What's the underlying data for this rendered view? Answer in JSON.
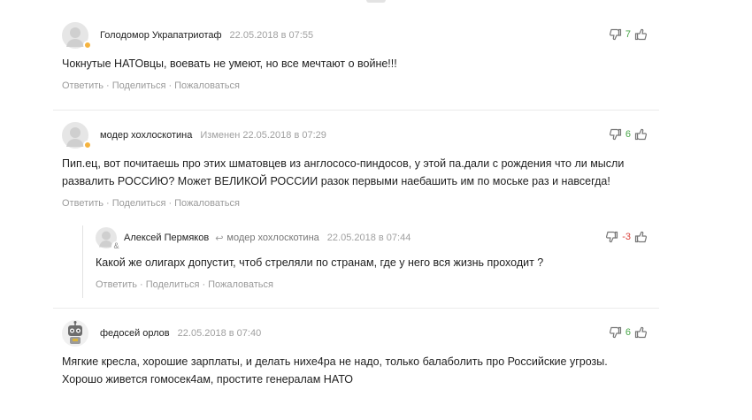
{
  "actions": {
    "reply": "Ответить",
    "share": "Поделиться",
    "report": "Пожаловаться",
    "separator": "·"
  },
  "reply_arrow": "↩",
  "comments": [
    {
      "author": "Голодомор Украпатриотаф",
      "meta": "22.05.2018 в 07:55",
      "score": "7",
      "score_sign": "positive",
      "text": "Чокнутые НАТОвцы, воевать не умеют, но все мечтают о войне!!!",
      "avatar": "default-avatar"
    },
    {
      "author": "модер хохлоскотина",
      "meta": "Изменен 22.05.2018 в 07:29",
      "score": "6",
      "score_sign": "positive",
      "text_lines": [
        "Пип.ец, вот почитаешь про этих шматовцев из англососо-пиндосов, у этой па.дали с рождения что ли мысли",
        "развалить РОССИЮ? Может ВЕЛИКОЙ РОССИИ разок первыми наебашить им по моське раз и навсегда!"
      ],
      "avatar": "default-avatar"
    },
    {
      "author": "Алексей Пермяков",
      "reply_to": "модер хохлоскотина",
      "meta": "22.05.2018 в 07:44",
      "score": "-3",
      "score_sign": "negative",
      "text": "Какой же олигарх допустит, чтоб стреляли по странам, где у него вся жизнь проходит ?",
      "avatar": "default-avatar"
    },
    {
      "author": "федосей орлов",
      "meta": "22.05.2018 в 07:40",
      "score": "6",
      "score_sign": "positive",
      "text_lines": [
        "Мягкие кресла, хорошие зарплаты, и делать нихе4ра не надо, только балаболить про Российские угрозы.",
        "Хорошо живется гомосек4ам, простите генералам НАТО"
      ],
      "avatar": "robot-avatar"
    }
  ],
  "colors": {
    "positive": "#4aa64a",
    "negative": "#d9413b",
    "avatar_badge": "#f5b33e"
  }
}
